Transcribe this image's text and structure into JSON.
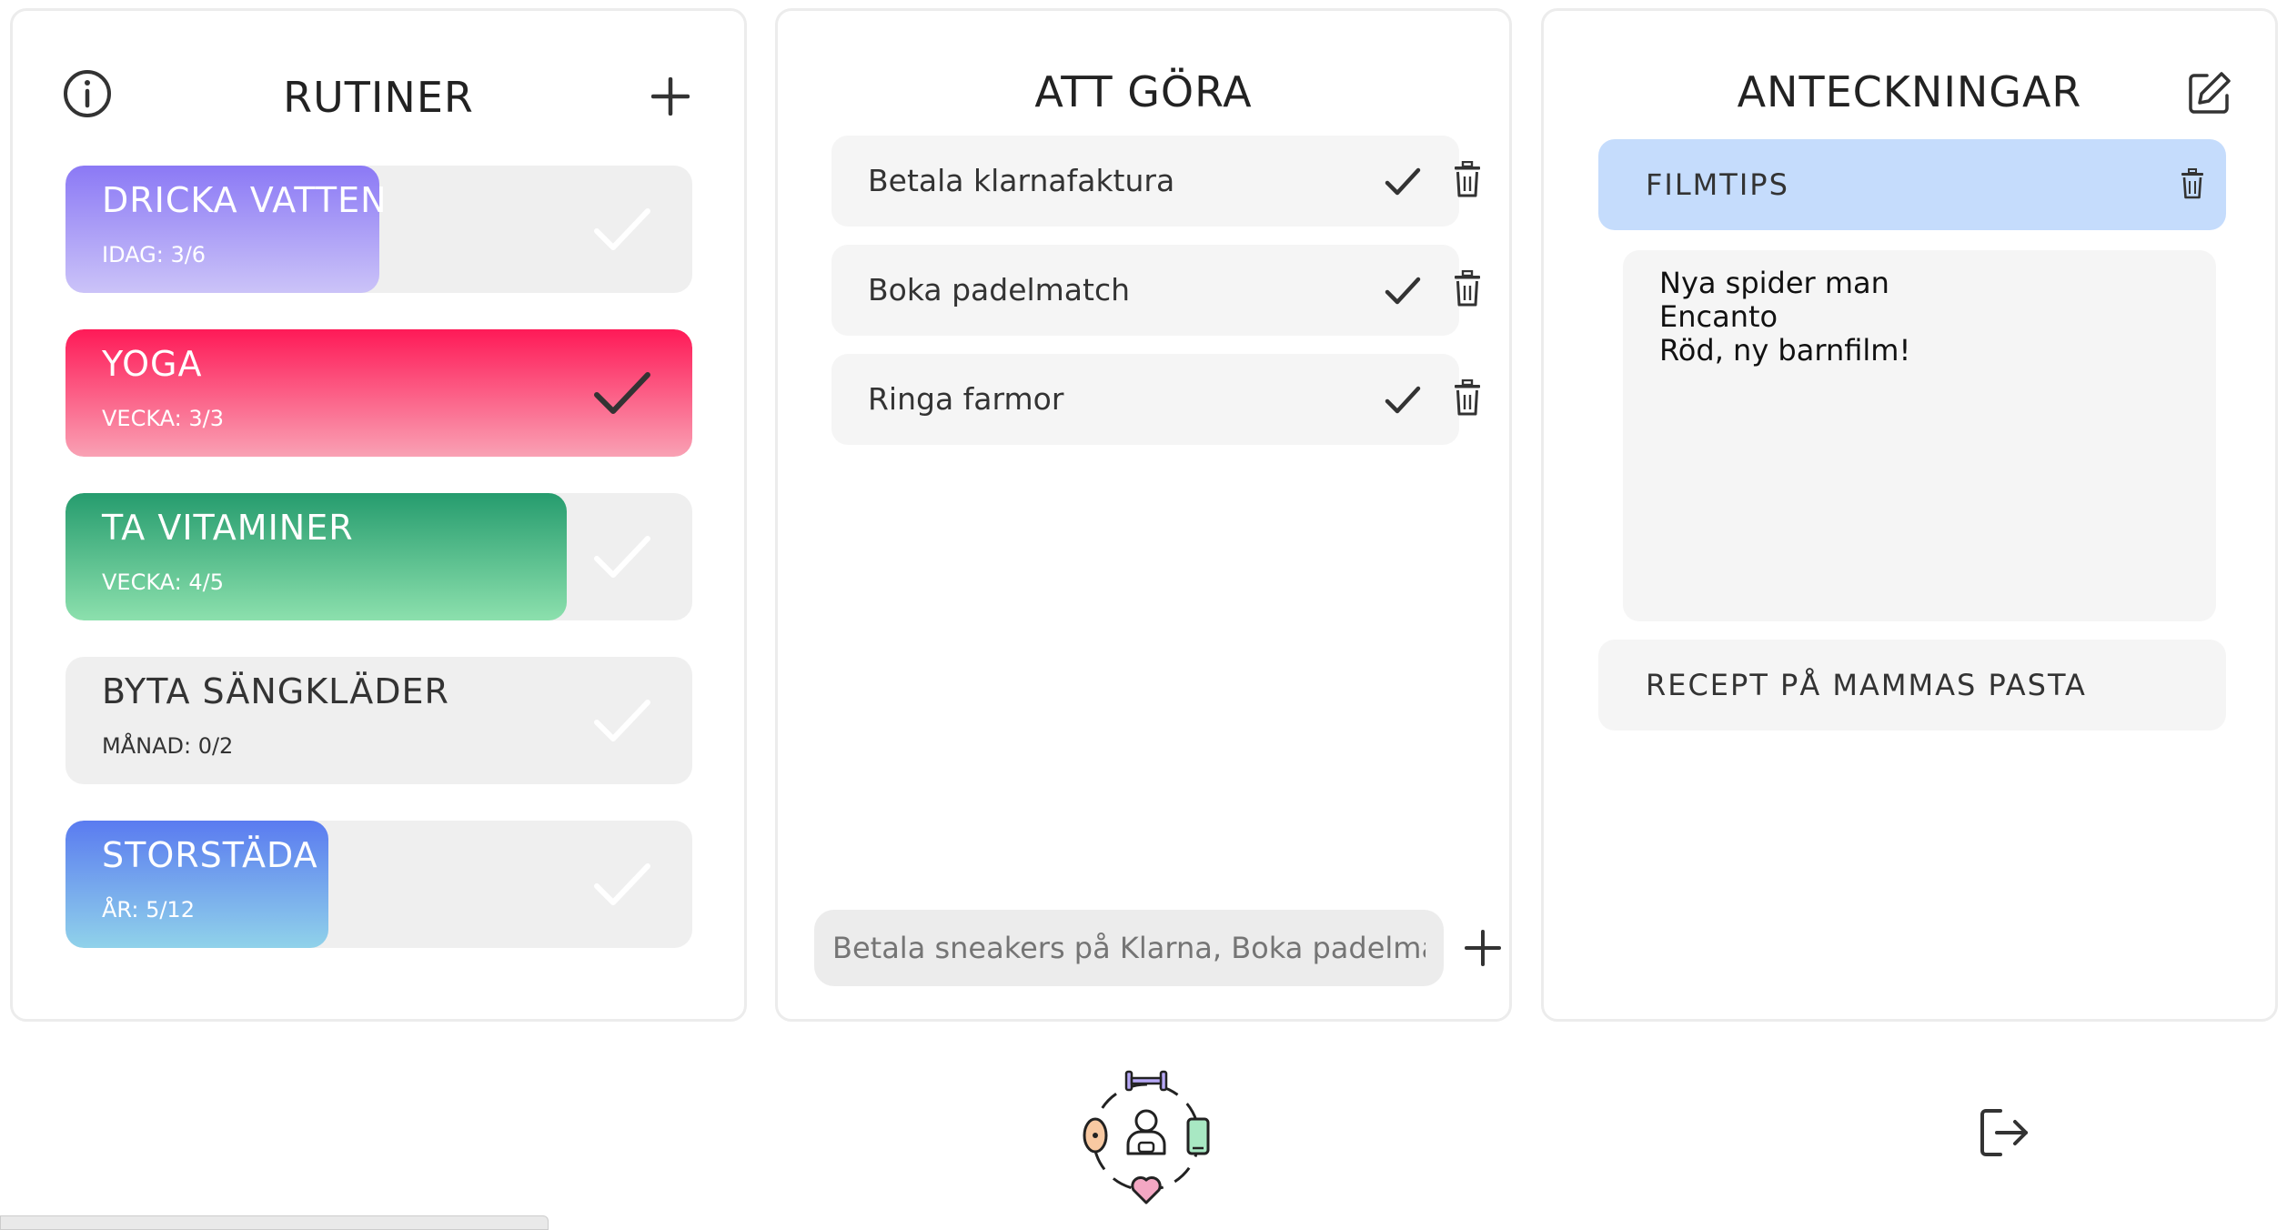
{
  "rutiner": {
    "title": "RUTINER",
    "items": [
      {
        "title": "DRICKA VATTEN",
        "sub": "IDAG: 3/6",
        "progress": 0.5,
        "done": false,
        "gradient": [
          "#8b79f5",
          "#cbc3f8"
        ]
      },
      {
        "title": "YOGA",
        "sub": "VECKA: 3/3",
        "progress": 1.0,
        "done": true,
        "gradient": [
          "#fe1a57",
          "#f9a1b4"
        ]
      },
      {
        "title": "TA VITAMINER",
        "sub": "VECKA: 4/5",
        "progress": 0.8,
        "done": false,
        "gradient": [
          "#269c6e",
          "#8ce0ad"
        ]
      },
      {
        "title": "BYTA SÄNGKLÄDER",
        "sub": "MÅNAD: 0/2",
        "progress": 0.0,
        "done": false,
        "gradient": [
          "#efefef",
          "#efefef"
        ]
      },
      {
        "title": "STORSTÄDA",
        "sub": "ÅR: 5/12",
        "progress": 0.42,
        "done": false,
        "gradient": [
          "#5a7bf0",
          "#90d2ea"
        ]
      }
    ]
  },
  "attgora": {
    "title": "ATT GÖRA",
    "items": [
      {
        "label": "Betala klarnafaktura"
      },
      {
        "label": "Boka padelmatch"
      },
      {
        "label": "Ringa farmor"
      }
    ],
    "input_placeholder": "Betala sneakers på Klarna, Boka padelmatch, ..."
  },
  "anteckningar": {
    "title": "ANTECKNINGAR",
    "notes": [
      {
        "title": "FILMTIPS",
        "active": true
      },
      {
        "title": "RECEPT PÅ MAMMAS PASTA",
        "active": false
      }
    ],
    "body_lines": [
      "Nya spider man",
      "Encanto",
      "Röd, ny barnfilm!"
    ]
  },
  "colors": {
    "check_dark": "#333333",
    "check_light": "#ffffff",
    "active_note": "#c5dcfc"
  },
  "icons": {
    "info": "info-icon",
    "add": "plus-icon",
    "edit": "edit-icon",
    "logout": "logout-icon",
    "logo": "app-logo"
  }
}
